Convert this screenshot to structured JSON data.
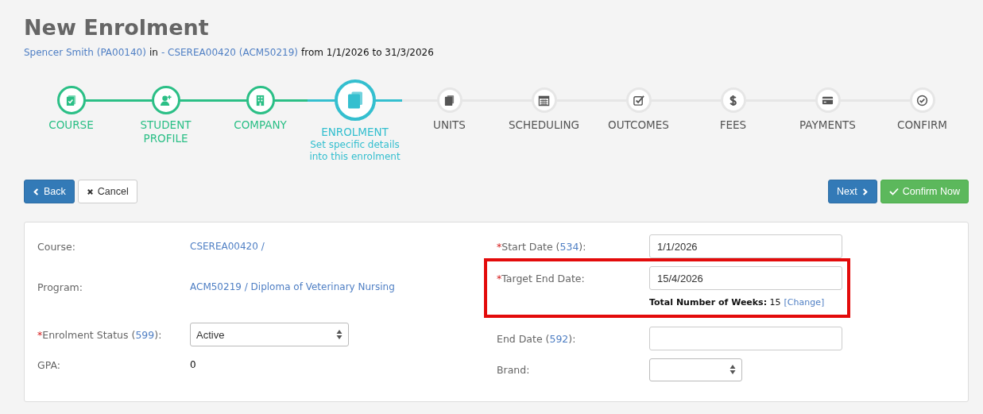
{
  "page": {
    "title": "New Enrolment",
    "subtitle": [
      {
        "kind": "link",
        "text": "Spencer Smith (PA00140)"
      },
      {
        "kind": "text",
        "text": "in"
      },
      {
        "kind": "link",
        "text": "- CSEREA00420 (ACM50219)"
      },
      {
        "kind": "text",
        "text": "from 1/1/2026 to 31/3/2026"
      }
    ]
  },
  "steps": [
    {
      "label": "COURSE",
      "completed": true,
      "selected": false
    },
    {
      "label": "STUDENT PROFILE",
      "completed": true,
      "selected": false
    },
    {
      "label": "COMPANY",
      "completed": true,
      "selected": false
    },
    {
      "label": "ENROLMENT",
      "completed": false,
      "selected": true,
      "description": "Set specific details into this enrolment"
    },
    {
      "label": "UNITS",
      "completed": false,
      "selected": false
    },
    {
      "label": "SCHEDULING",
      "completed": false,
      "selected": false
    },
    {
      "label": "OUTCOMES",
      "completed": false,
      "selected": false
    },
    {
      "label": "FEES",
      "completed": false,
      "selected": false
    },
    {
      "label": "PAYMENTS",
      "completed": false,
      "selected": false
    },
    {
      "label": "CONFIRM",
      "completed": false,
      "selected": false
    }
  ],
  "toolbar": {
    "left": [
      {
        "label": "Back",
        "kind": "primary"
      },
      {
        "label": "Cancel",
        "kind": "default"
      }
    ],
    "right": [
      {
        "label": "Next",
        "kind": "primary"
      },
      {
        "label": "Confirm Now",
        "kind": "success"
      }
    ]
  },
  "form": {
    "left": [
      {
        "label": [
          {
            "kind": "text",
            "text": "Course:"
          }
        ],
        "kind": "link",
        "value": "CSEREA00420 /"
      },
      {
        "label": [
          {
            "kind": "text",
            "text": "Program:"
          }
        ],
        "kind": "link",
        "value": "ACM50219 / Diploma of Veterinary Nursing"
      },
      {
        "label": [
          {
            "kind": "required",
            "text": "*"
          },
          {
            "kind": "text",
            "text": "Enrolment Status ("
          },
          {
            "kind": "link",
            "text": "599"
          },
          {
            "kind": "text",
            "text": "):"
          }
        ],
        "kind": "select",
        "value": "Active"
      },
      {
        "label": [
          {
            "kind": "text",
            "text": "GPA:"
          }
        ],
        "kind": "text",
        "value": "0"
      }
    ],
    "right": [
      {
        "label": [
          {
            "kind": "required",
            "text": "*"
          },
          {
            "kind": "text",
            "text": "Start Date ("
          },
          {
            "kind": "link",
            "text": "534"
          },
          {
            "kind": "text",
            "text": "):"
          }
        ],
        "kind": "input",
        "value": "1/1/2026",
        "highlighted": false
      },
      {
        "label": [
          {
            "kind": "required",
            "text": "*"
          },
          {
            "kind": "text",
            "text": "Target End Date:"
          }
        ],
        "kind": "input",
        "value": "15/4/2026",
        "highlighted": true,
        "note": "**Total Number of Weeks:** 15",
        "note_link": "[Change]"
      },
      {
        "label": [
          {
            "kind": "text",
            "text": "End Date ("
          },
          {
            "kind": "link",
            "text": "592"
          },
          {
            "kind": "text",
            "text": "):"
          }
        ],
        "kind": "input",
        "highlighted": false
      },
      {
        "label": [
          {
            "kind": "text",
            "text": "Brand:"
          }
        ],
        "kind": "select",
        "highlighted": false
      }
    ]
  }
}
